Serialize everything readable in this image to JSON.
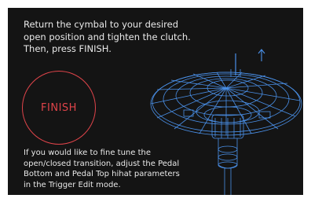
{
  "instruction_text": "Return the cymbal to your desired\nopen position and tighten the clutch.\nThen, press FINISH.",
  "finish_label": "FINISH",
  "hint_text": "If you would like to fine tune the\nopen/closed transition, adjust the Pedal\nBottom and Pedal Top hihat parameters\nin the Trigger Edit mode.",
  "colors": {
    "background": "#141414",
    "text": "#e9e9e9",
    "accent_red": "#e0444a",
    "cymbal_blue": "#4a90e8"
  },
  "icons": {
    "direction_arrow": "arrow-up-icon",
    "cymbal": "hihat-cymbal-wireframe"
  }
}
